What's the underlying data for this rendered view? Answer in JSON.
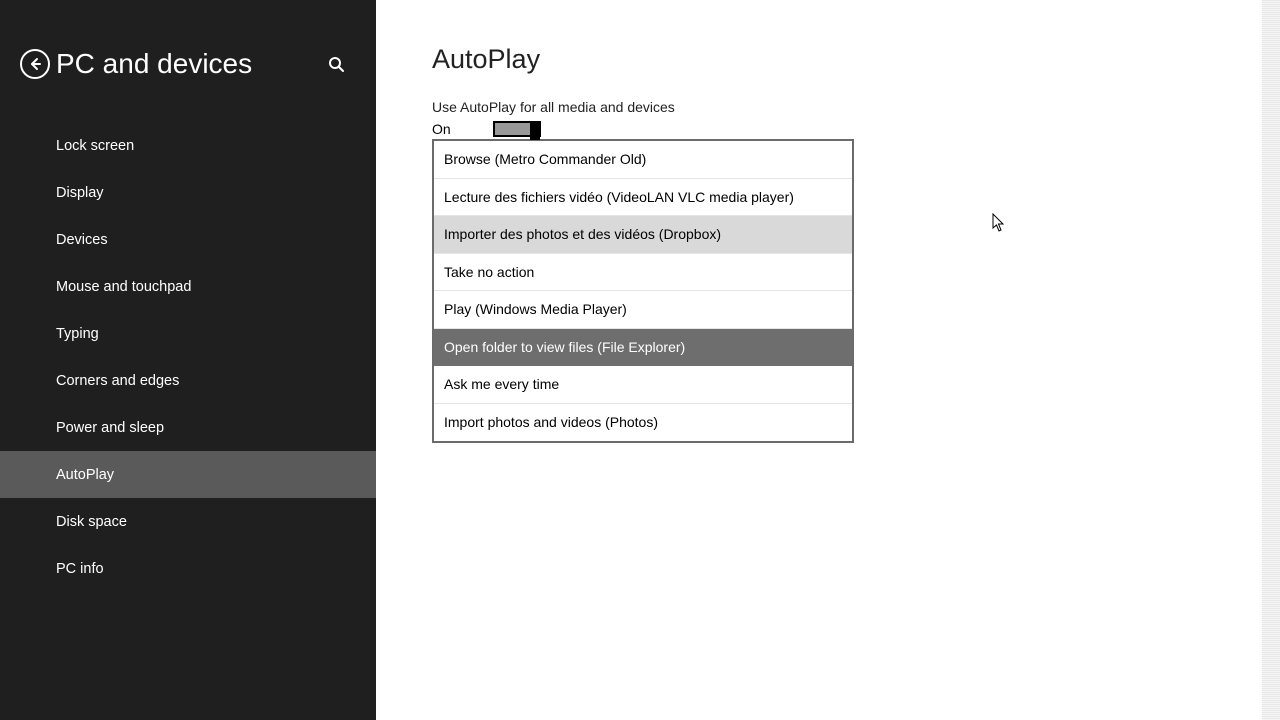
{
  "sidebar": {
    "title": "PC and devices",
    "items": [
      {
        "label": "Lock screen",
        "active": false
      },
      {
        "label": "Display",
        "active": false
      },
      {
        "label": "Devices",
        "active": false
      },
      {
        "label": "Mouse and touchpad",
        "active": false
      },
      {
        "label": "Typing",
        "active": false
      },
      {
        "label": "Corners and edges",
        "active": false
      },
      {
        "label": "Power and sleep",
        "active": false
      },
      {
        "label": "AutoPlay",
        "active": true
      },
      {
        "label": "Disk space",
        "active": false
      },
      {
        "label": "PC info",
        "active": false
      }
    ]
  },
  "main": {
    "title": "AutoPlay",
    "toggle_label": "Use AutoPlay for all media and devices",
    "toggle_state": "On",
    "dropdown": {
      "options": [
        {
          "label": "Browse (Metro Commander Old)",
          "state": "normal"
        },
        {
          "label": "Lecture des fichiers vidéo (VideoLAN VLC media player)",
          "state": "normal"
        },
        {
          "label": "Importer des photos et des vidéos (Dropbox)",
          "state": "hover"
        },
        {
          "label": "Take no action",
          "state": "normal"
        },
        {
          "label": "Play (Windows Media Player)",
          "state": "normal"
        },
        {
          "label": "Open folder to view files (File Explorer)",
          "state": "selected"
        },
        {
          "label": "Ask me every time",
          "state": "normal"
        },
        {
          "label": "Import photos and videos (Photos)",
          "state": "normal"
        }
      ]
    }
  }
}
